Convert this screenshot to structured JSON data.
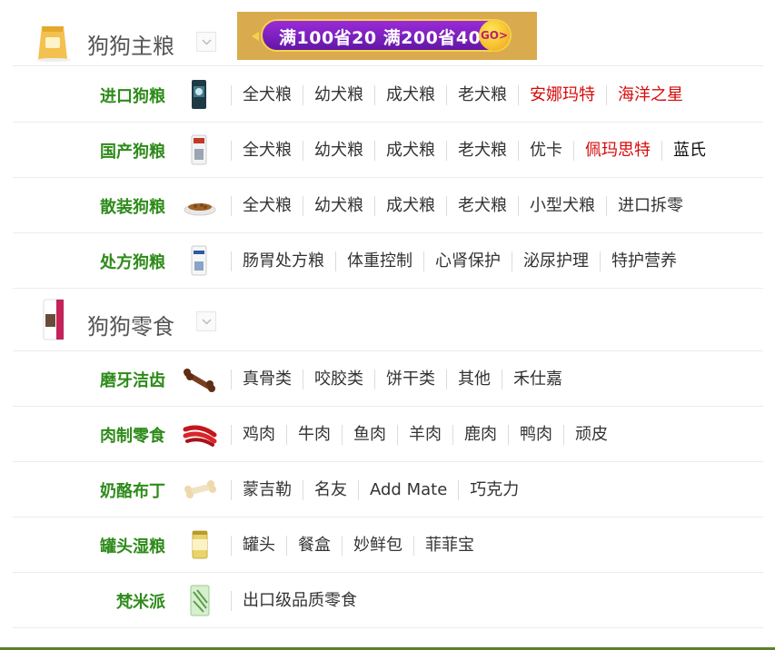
{
  "sections": [
    {
      "title": "狗狗主粮",
      "banner": {
        "text": "满100省20 满200省40",
        "go": "GO>"
      },
      "rows": [
        {
          "name": "进口狗粮",
          "links": [
            {
              "text": "全犬粮",
              "style": "normal"
            },
            {
              "text": "幼犬粮",
              "style": "normal"
            },
            {
              "text": "成犬粮",
              "style": "normal"
            },
            {
              "text": "老犬粮",
              "style": "normal"
            },
            {
              "text": "安娜玛特",
              "style": "red"
            },
            {
              "text": "海洋之星",
              "style": "red"
            }
          ]
        },
        {
          "name": "国产狗粮",
          "links": [
            {
              "text": "全犬粮",
              "style": "normal"
            },
            {
              "text": "幼犬粮",
              "style": "normal"
            },
            {
              "text": "成犬粮",
              "style": "normal"
            },
            {
              "text": "老犬粮",
              "style": "normal"
            },
            {
              "text": "优卡",
              "style": "normal"
            },
            {
              "text": "佩玛思特",
              "style": "red"
            },
            {
              "text": "蓝氏",
              "style": "black"
            }
          ]
        },
        {
          "name": "散装狗粮",
          "links": [
            {
              "text": "全犬粮",
              "style": "normal"
            },
            {
              "text": "幼犬粮",
              "style": "normal"
            },
            {
              "text": "成犬粮",
              "style": "normal"
            },
            {
              "text": "老犬粮",
              "style": "normal"
            },
            {
              "text": "小型犬粮",
              "style": "normal"
            },
            {
              "text": "进口拆零",
              "style": "normal"
            }
          ]
        },
        {
          "name": "处方狗粮",
          "links": [
            {
              "text": "肠胃处方粮",
              "style": "normal"
            },
            {
              "text": "体重控制",
              "style": "normal"
            },
            {
              "text": "心肾保护",
              "style": "normal"
            },
            {
              "text": "泌尿护理",
              "style": "normal"
            },
            {
              "text": "特护营养",
              "style": "normal"
            }
          ]
        }
      ]
    },
    {
      "title": "狗狗零食",
      "rows": [
        {
          "name": "磨牙洁齿",
          "links": [
            {
              "text": "真骨类",
              "style": "normal"
            },
            {
              "text": "咬胶类",
              "style": "normal"
            },
            {
              "text": "饼干类",
              "style": "normal"
            },
            {
              "text": "其他",
              "style": "normal"
            },
            {
              "text": "禾仕嘉",
              "style": "normal"
            }
          ]
        },
        {
          "name": "肉制零食",
          "links": [
            {
              "text": "鸡肉",
              "style": "normal"
            },
            {
              "text": "牛肉",
              "style": "normal"
            },
            {
              "text": "鱼肉",
              "style": "normal"
            },
            {
              "text": "羊肉",
              "style": "normal"
            },
            {
              "text": "鹿肉",
              "style": "normal"
            },
            {
              "text": "鸭肉",
              "style": "normal"
            },
            {
              "text": "顽皮",
              "style": "normal"
            }
          ]
        },
        {
          "name": "奶酪布丁",
          "links": [
            {
              "text": "蒙吉勒",
              "style": "normal"
            },
            {
              "text": "名友",
              "style": "normal"
            },
            {
              "text": "Add Mate",
              "style": "normal"
            },
            {
              "text": "巧克力",
              "style": "normal"
            }
          ]
        },
        {
          "name": "罐头湿粮",
          "links": [
            {
              "text": "罐头",
              "style": "normal"
            },
            {
              "text": "餐盒",
              "style": "normal"
            },
            {
              "text": "妙鲜包",
              "style": "normal"
            },
            {
              "text": "菲菲宝",
              "style": "normal"
            }
          ]
        },
        {
          "name": "梵米派",
          "links": [
            {
              "text": "出口级品质零食",
              "style": "normal"
            }
          ]
        }
      ]
    }
  ]
}
